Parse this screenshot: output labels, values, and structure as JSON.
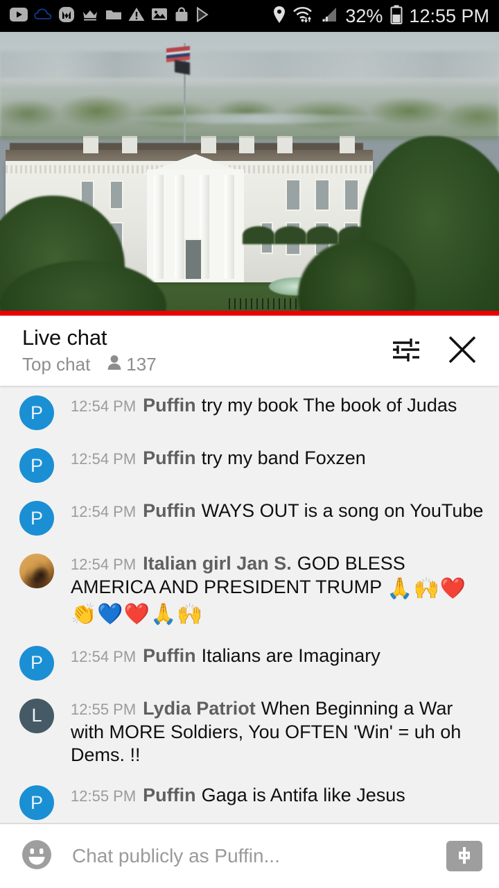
{
  "status_bar": {
    "icons": [
      "youtube-icon",
      "cloud-icon",
      "m-app-icon",
      "crown-icon",
      "folder-icon",
      "warning-icon",
      "photos-icon",
      "shopping-bag-icon",
      "play-store-icon"
    ],
    "right_icons": [
      "location-icon",
      "wifi-icon",
      "signal-icon",
      "battery-icon"
    ],
    "battery_percent": "32%",
    "clock": "12:55 PM"
  },
  "player": {
    "name": "white-house-live-stream",
    "progress_color": "#ee0000"
  },
  "chat_header": {
    "title": "Live chat",
    "subtitle": "Top chat",
    "viewer_count": "137",
    "settings_icon": "tune-icon",
    "close_icon": "close-icon"
  },
  "messages": [
    {
      "avatar_type": "letter",
      "avatar_letter": "P",
      "avatar_color": "#1a8fd4",
      "timestamp": "12:54 PM",
      "author": "Puffin",
      "text": "try my book The book of Judas",
      "emoji": ""
    },
    {
      "avatar_type": "letter",
      "avatar_letter": "P",
      "avatar_color": "#1a8fd4",
      "timestamp": "12:54 PM",
      "author": "Puffin",
      "text": "try my band Foxzen",
      "emoji": ""
    },
    {
      "avatar_type": "letter",
      "avatar_letter": "P",
      "avatar_color": "#1a8fd4",
      "timestamp": "12:54 PM",
      "author": "Puffin",
      "text": "WAYS OUT is a song on YouTube",
      "emoji": ""
    },
    {
      "avatar_type": "photo",
      "avatar_letter": "",
      "avatar_color": "#c58f45",
      "timestamp": "12:54 PM",
      "author": "Italian girl Jan S.",
      "text": "GOD BLESS AMERICA AND PRESIDENT TRUMP ",
      "emoji": "🙏🙌❤️👏💙❤️🙏🙌"
    },
    {
      "avatar_type": "letter",
      "avatar_letter": "P",
      "avatar_color": "#1a8fd4",
      "timestamp": "12:54 PM",
      "author": "Puffin",
      "text": "Italians are Imaginary",
      "emoji": ""
    },
    {
      "avatar_type": "letter",
      "avatar_letter": "L",
      "avatar_color": "#455a64",
      "timestamp": "12:55 PM",
      "author": "Lydia Patriot",
      "text": "When Beginning a War with MORE Soldiers, You OFTEN 'Win' = uh oh Dems. !!",
      "emoji": ""
    },
    {
      "avatar_type": "letter",
      "avatar_letter": "P",
      "avatar_color": "#1a8fd4",
      "timestamp": "12:55 PM",
      "author": "Puffin",
      "text": "Gaga is Antifa like Jesus",
      "emoji": ""
    }
  ],
  "input_bar": {
    "emoji_icon": "smiley-icon",
    "placeholder": "Chat publicly as Puffin...",
    "superchat_icon": "dollar-icon",
    "value": ""
  }
}
